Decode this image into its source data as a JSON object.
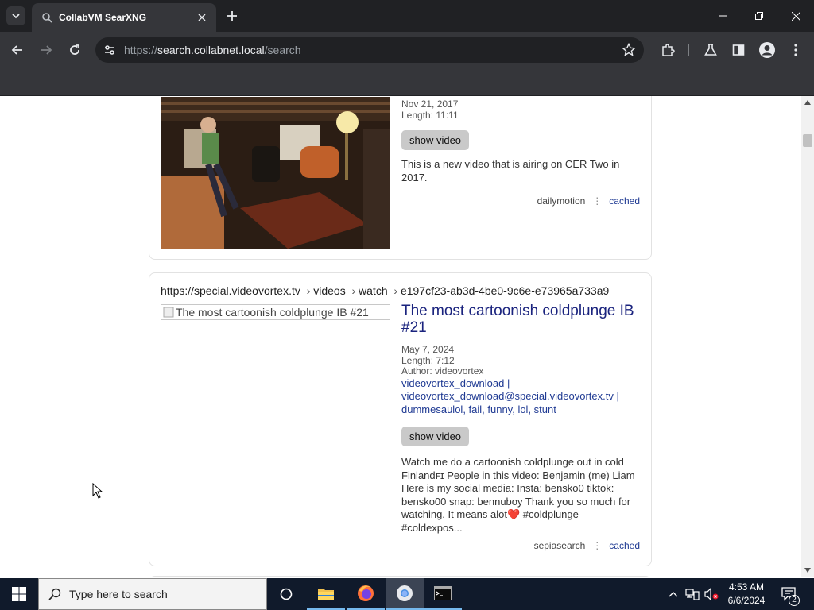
{
  "browser": {
    "tab_title": "CollabVM SearXNG",
    "url_scheme": "https://",
    "url_host": "search.collabnet.local",
    "url_path": "/search"
  },
  "results": [
    {
      "date": "Nov 21, 2017",
      "length": "Length: 11:11",
      "show_video_label": "show video",
      "description": "This is a new video that is airing on CER Two in 2017.",
      "engine": "dailymotion",
      "cached_label": "cached"
    },
    {
      "url_host": "https://special.videovortex.tv",
      "url_path_1": "videos",
      "url_path_2": "watch",
      "url_path_3": "e197cf23-ab3d-4be0-9c6e-e73965a733a9",
      "thumb_alt": "The most cartoonish coldplunge IB #21",
      "title": "The most cartoonish coldplunge IB #21",
      "date": "May 7, 2024",
      "length": "Length: 7:12",
      "author": "Author: videovortex",
      "links": "videovortex_download | videovortex_download@special.videovortex.tv | dummesaulol, fail, funny, lol, stunt",
      "show_video_label": "show video",
      "description": "Watch me do a cartoonish coldplunge out in cold Finlandꜰɪ People in this video: Benjamin (me) Liam Here is my social media: Insta: bensko0 tiktok: bensko00 snap: bennuboy Thank you so much for watching. It means alot❤️ #coldplunge #coldexpos...",
      "engine": "sepiasearch",
      "cached_label": "cached"
    }
  ],
  "taskbar": {
    "search_placeholder": "Type here to search",
    "time": "4:53 AM",
    "date": "6/6/2024",
    "notification_count": "2"
  }
}
